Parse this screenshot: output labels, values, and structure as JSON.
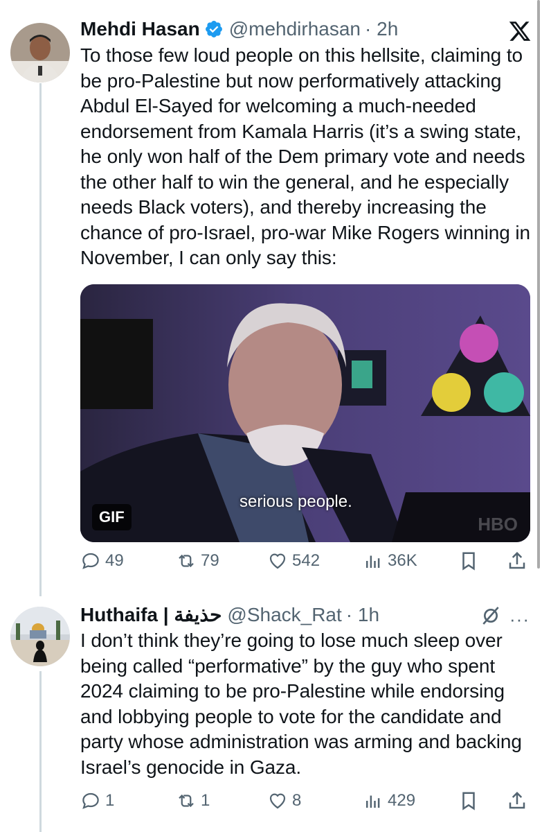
{
  "tweet1": {
    "name": "Mehdi Hasan",
    "handle": "@mehdirhasan",
    "time": "· 2h",
    "text": "To those few loud people on this hellsite, claiming to be pro-Palestine but now performatively attacking Abdul El-Sayed for welcoming a much-needed endorsement from Kamala Harris (it’s a swing state, he only won half of the Dem primary vote and needs the other half to win the general, and he especially needs Black voters), and thereby increasing the chance of pro-Israel, pro-war Mike Rogers winning in November, I can only say this:",
    "media": {
      "badge": "GIF",
      "subtitle": "serious people.",
      "watermark": "HBO"
    },
    "stats": {
      "replies": "49",
      "reposts": "79",
      "likes": "542",
      "views": "36K"
    }
  },
  "tweet2": {
    "name": "Huthaifa | حذيفة",
    "handle": "@Shack_Rat",
    "time": "· 1h",
    "text": "I don’t think they’re going to lose much sleep over being called “performative” by the guy who spent 2024 claiming to be pro-Palestine while endorsing and lobbying people to vote for the candidate and party whose administration was arming and backing Israel’s genocide in Gaza.",
    "stats": {
      "replies": "1",
      "reposts": "1",
      "likes": "8",
      "views": "429"
    }
  },
  "more_label": "···",
  "colors": {
    "verified": "#1d9bf0",
    "muted": "#536471"
  }
}
